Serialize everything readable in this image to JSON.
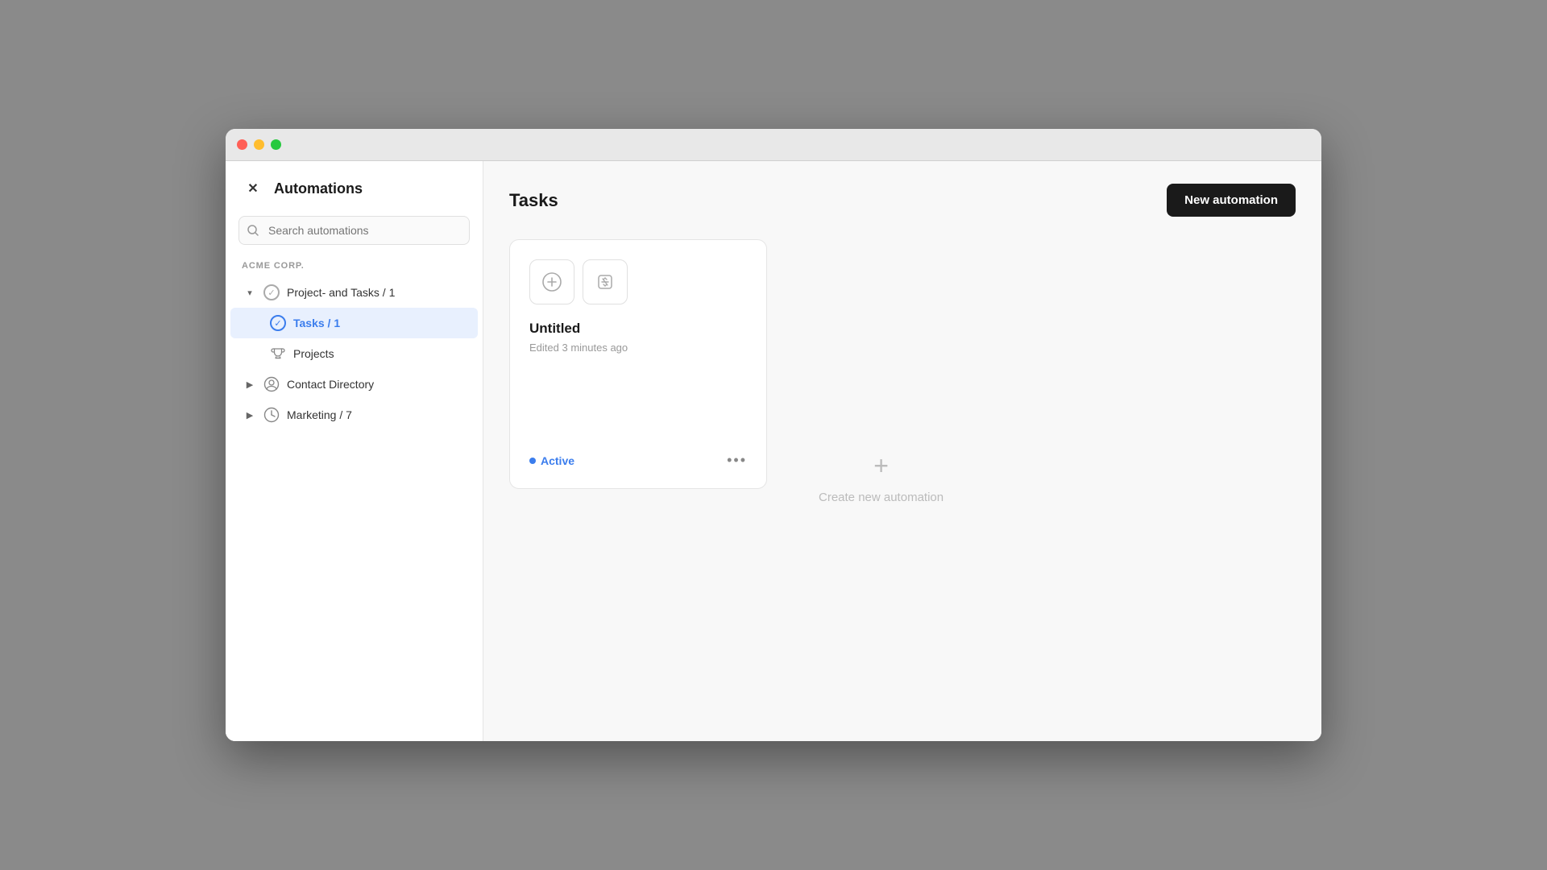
{
  "window": {
    "titlebar": {
      "traffic_lights": [
        "red",
        "yellow",
        "green"
      ]
    }
  },
  "sidebar": {
    "title": "Automations",
    "search": {
      "placeholder": "Search automations"
    },
    "section_label": "ACME CORP.",
    "items": [
      {
        "id": "project-and-tasks",
        "label": "Project- and Tasks / 1",
        "icon_type": "check-circle-grey",
        "expanded": true,
        "children": [
          {
            "id": "tasks",
            "label": "Tasks / 1",
            "icon_type": "check-circle-blue",
            "active": true
          },
          {
            "id": "projects",
            "label": "Projects",
            "icon_type": "trophy"
          }
        ]
      },
      {
        "id": "contact-directory",
        "label": "Contact Directory",
        "icon_type": "person-circle",
        "expanded": false
      },
      {
        "id": "marketing",
        "label": "Marketing / 7",
        "icon_type": "clock-circle",
        "expanded": false
      }
    ]
  },
  "main": {
    "title": "Tasks",
    "new_automation_label": "New automation",
    "card": {
      "title": "Untitled",
      "subtitle": "Edited 3 minutes ago",
      "status": "Active",
      "more_icon": "•••"
    },
    "create_new": {
      "label": "Create new automation",
      "plus": "+"
    }
  }
}
